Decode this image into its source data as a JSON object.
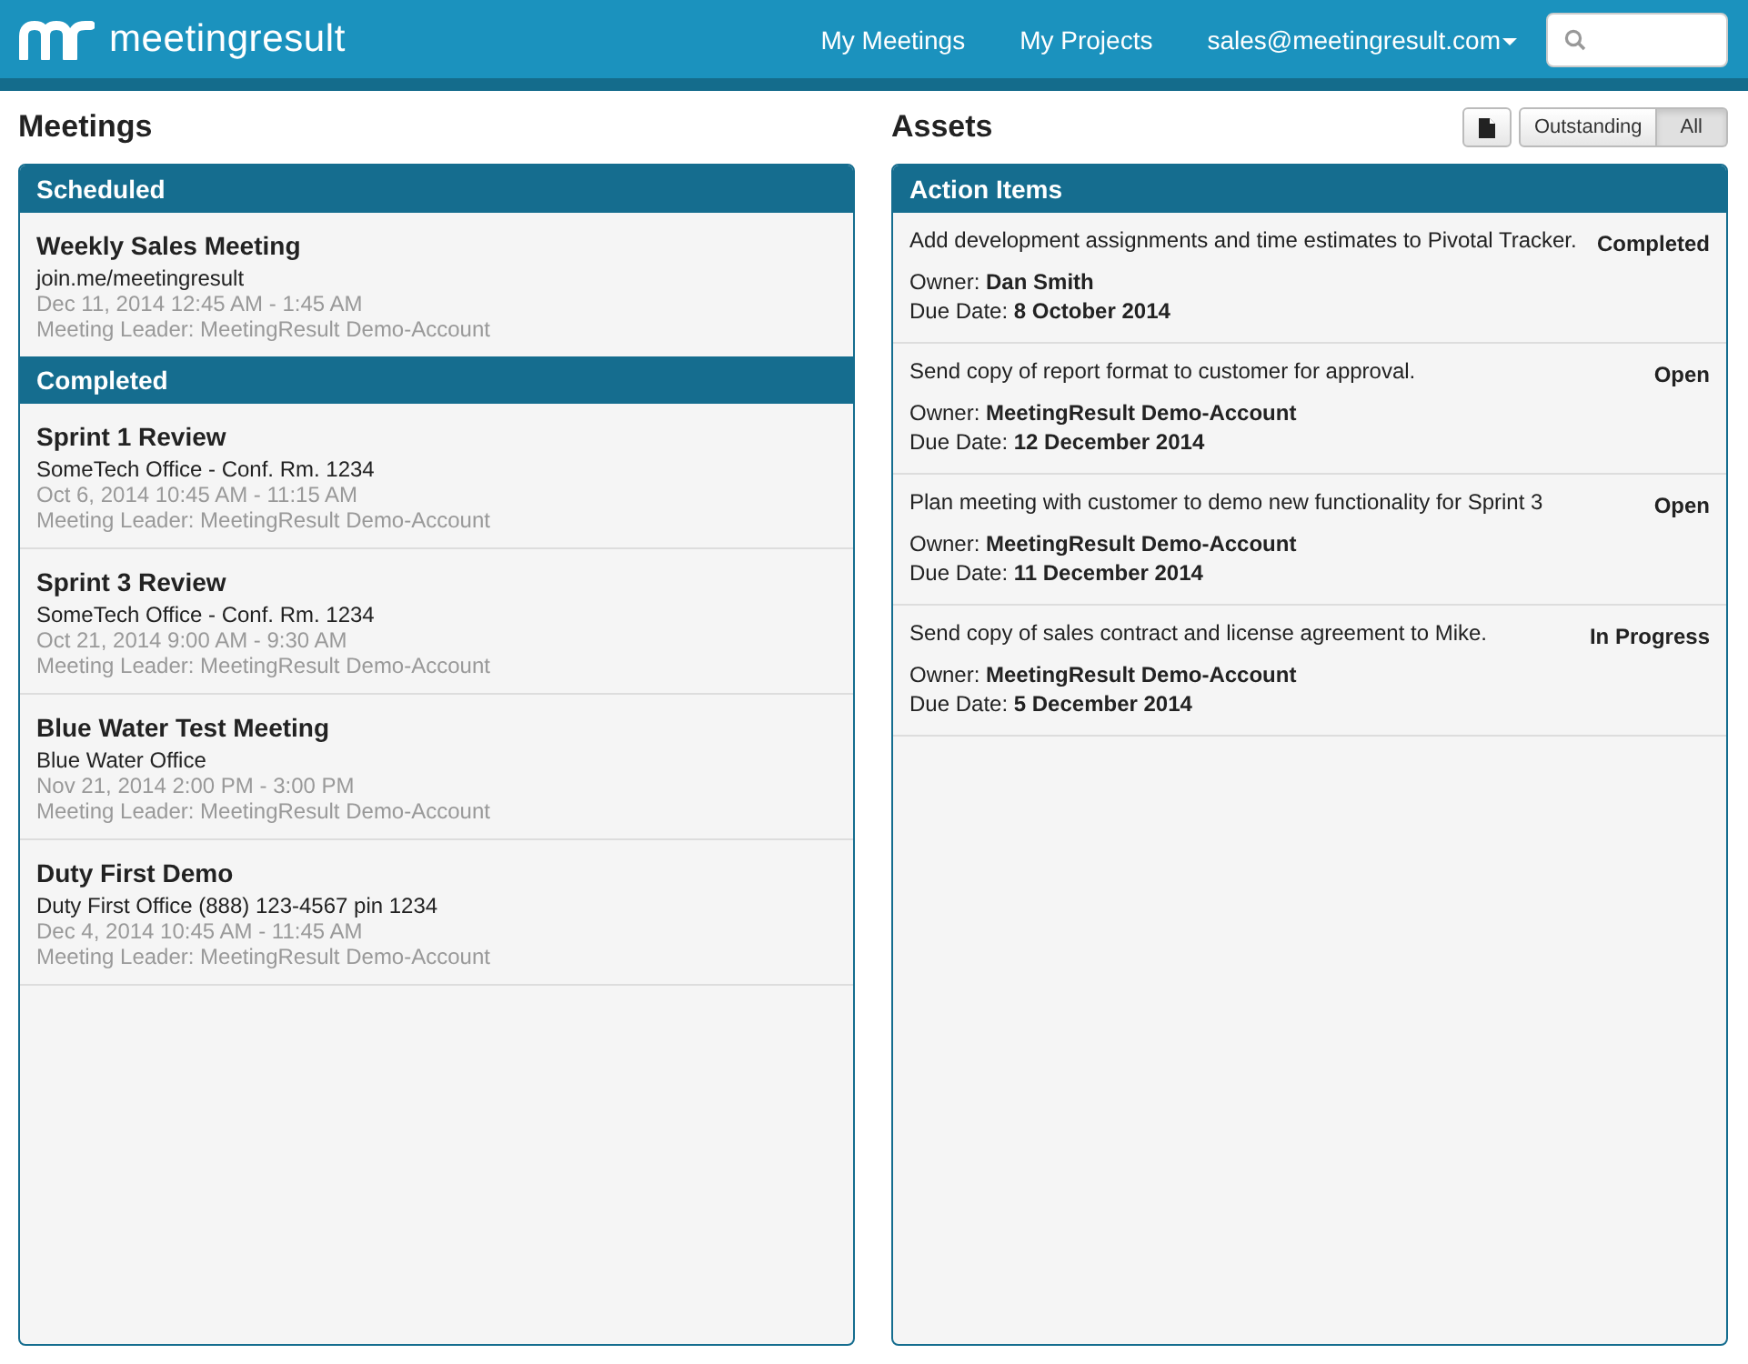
{
  "navbar": {
    "brand": "meetingresult",
    "links": [
      "My Meetings",
      "My Projects"
    ],
    "account": "sales@meetingresult.com"
  },
  "meetings": {
    "title": "Meetings",
    "sections": [
      {
        "heading": "Scheduled",
        "items": [
          {
            "title": "Weekly Sales Meeting",
            "location": "join.me/meetingresult",
            "time": "Dec 11, 2014 12:45 AM - 1:45 AM",
            "leader": "Meeting Leader: MeetingResult Demo-Account"
          }
        ]
      },
      {
        "heading": "Completed",
        "items": [
          {
            "title": "Sprint 1 Review",
            "location": "SomeTech Office - Conf. Rm. 1234",
            "time": "Oct 6, 2014 10:45 AM - 11:15 AM",
            "leader": "Meeting Leader: MeetingResult Demo-Account"
          },
          {
            "title": "Sprint 3 Review",
            "location": "SomeTech Office - Conf. Rm. 1234",
            "time": "Oct 21, 2014 9:00 AM - 9:30 AM",
            "leader": "Meeting Leader: MeetingResult Demo-Account"
          },
          {
            "title": "Blue Water Test Meeting",
            "location": "Blue Water Office",
            "time": "Nov 21, 2014 2:00 PM - 3:00 PM",
            "leader": "Meeting Leader: MeetingResult Demo-Account"
          },
          {
            "title": "Duty First Demo",
            "location": "Duty First Office (888) 123-4567 pin 1234",
            "time": "Dec 4, 2014 10:45 AM - 11:45 AM",
            "leader": "Meeting Leader: MeetingResult Demo-Account"
          }
        ]
      }
    ]
  },
  "assets": {
    "title": "Assets",
    "filters": [
      {
        "label": "Outstanding",
        "selected": false
      },
      {
        "label": "All",
        "selected": true
      }
    ],
    "panel_title": "Action Items",
    "items": [
      {
        "description": "Add development assignments and time estimates to Pivotal Tracker.",
        "status": "Completed",
        "owner": "Owner: **Dan Smith**",
        "due": "Due Date: **8 October 2014**"
      },
      {
        "description": "Send copy of report format to customer for approval.",
        "status": "Open",
        "owner": "Owner: **MeetingResult Demo-Account**",
        "due": "Due Date: **12 December 2014**"
      },
      {
        "description": "Plan meeting with customer to demo new functionality for Sprint 3",
        "status": "Open",
        "owner": "Owner: **MeetingResult Demo-Account**",
        "due": "Due Date: **11 December 2014**"
      },
      {
        "description": "Send copy of sales contract and license agreement to Mike.",
        "status": "In Progress",
        "owner": "Owner: **MeetingResult Demo-Account**",
        "due": "Due Date: **5 December 2014**"
      }
    ]
  }
}
